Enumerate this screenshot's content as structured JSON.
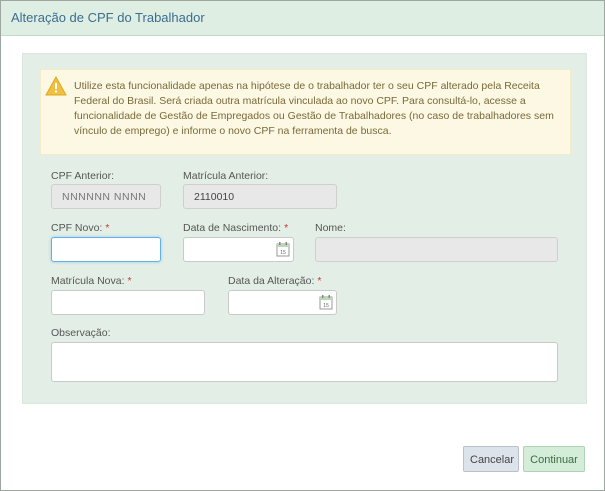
{
  "dialog": {
    "title": "Alteração de CPF do Trabalhador"
  },
  "alert": {
    "icon": "warning-icon",
    "text": "Utilize esta funcionalidade apenas na hipótese de o trabalhador ter o seu CPF alterado pela Receita Federal do Brasil. Será criada outra matrícula vinculada ao novo CPF. Para consultá-lo, acesse a funcionalidade de Gestão de Empregados ou Gestão de Trabalhadores (no caso de trabalhadores sem vínculo de emprego) e informe o novo CPF na ferramenta de busca.",
    "color": "#fcf8e3"
  },
  "form": {
    "cpf_anterior": {
      "label": "CPF Anterior:",
      "value": "NNNNNN NNNN"
    },
    "matricula_anterior": {
      "label": "Matrícula Anterior:",
      "value": "2110010"
    },
    "cpf_novo": {
      "label": "CPF Novo:",
      "required": "*",
      "value": ""
    },
    "data_nascimento": {
      "label": "Data de Nascimento:",
      "required": "*",
      "value": ""
    },
    "nome": {
      "label": "Nome:",
      "value": ""
    },
    "matricula_nova": {
      "label": "Matrícula Nova:",
      "required": "*",
      "value": ""
    },
    "data_alteracao": {
      "label": "Data da Alteração:",
      "required": "*",
      "value": ""
    },
    "observacao": {
      "label": "Observação:",
      "value": ""
    }
  },
  "buttons": {
    "cancel": "Cancelar",
    "continue": "Continuar"
  },
  "colors": {
    "header_bg": "#dfeee3",
    "panel_bg": "#e3efe6",
    "title": "#3a6d8f"
  }
}
